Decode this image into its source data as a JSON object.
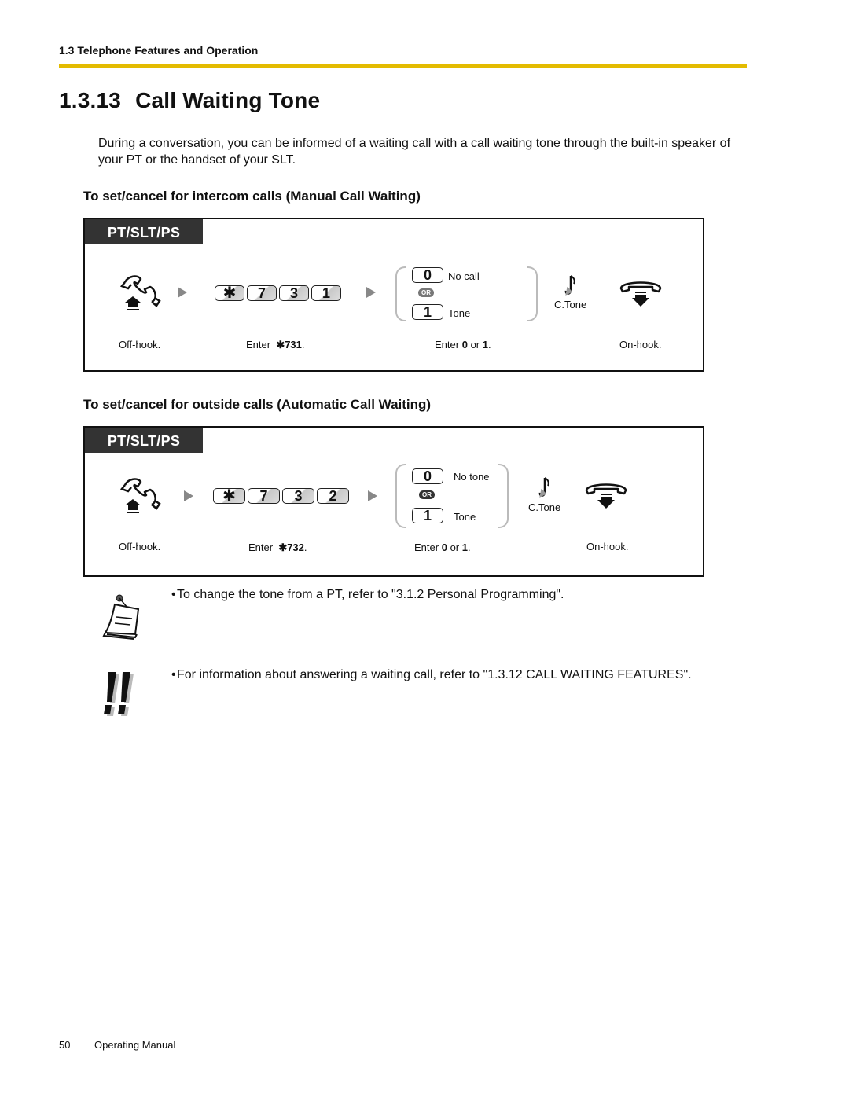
{
  "header": {
    "section": "1.3 Telephone Features and Operation",
    "rule_color": "#e3bb00"
  },
  "title": {
    "number": "1.3.13",
    "text": "Call Waiting Tone"
  },
  "intro": "During a conversation, you can be informed of a waiting call with a call waiting tone through the built-in speaker of your PT or the handset of your SLT.",
  "procedures": [
    {
      "heading": "To set/cancel for intercom calls (Manual Call Waiting)",
      "tab": "PT/SLT/PS",
      "keys": [
        "✱",
        "7",
        "3",
        "1"
      ],
      "options": [
        {
          "key": "0",
          "label": "No call"
        },
        {
          "key": "1",
          "label": "Tone"
        }
      ],
      "or_label": "OR",
      "tone_label": "C.Tone",
      "captions": {
        "offhook": "Off-hook.",
        "enter_prefix": "Enter",
        "enter_code": "✱731",
        "enter_suffix": ".",
        "choice_prefix": "Enter",
        "choice_a": "0",
        "choice_or": "or",
        "choice_b": "1",
        "choice_suffix": ".",
        "onhook": "On-hook."
      }
    },
    {
      "heading": "To set/cancel for outside calls (Automatic Call Waiting)",
      "tab": "PT/SLT/PS",
      "keys": [
        "✱",
        "7",
        "3",
        "2"
      ],
      "options": [
        {
          "key": "0",
          "label": "No tone"
        },
        {
          "key": "1",
          "label": "Tone"
        }
      ],
      "or_label": "OR",
      "tone_label": "C.Tone",
      "captions": {
        "offhook": "Off-hook.",
        "enter_prefix": "Enter",
        "enter_code": "✱732",
        "enter_suffix": ".",
        "choice_prefix": "Enter",
        "choice_a": "0",
        "choice_or": "or",
        "choice_b": "1",
        "choice_suffix": ".",
        "onhook": "On-hook."
      }
    }
  ],
  "notes": [
    {
      "icon": "memo-note-icon",
      "bullet": "•",
      "text": "To change the tone from a PT, refer to \"3.1.2 Personal Programming\"."
    },
    {
      "icon": "double-exclamation-icon",
      "bullet": "•",
      "text": "For information about answering a waiting call, refer to \"1.3.12 CALL WAITING FEATURES\"."
    }
  ],
  "footer": {
    "page_number": "50",
    "label": "Operating Manual"
  }
}
